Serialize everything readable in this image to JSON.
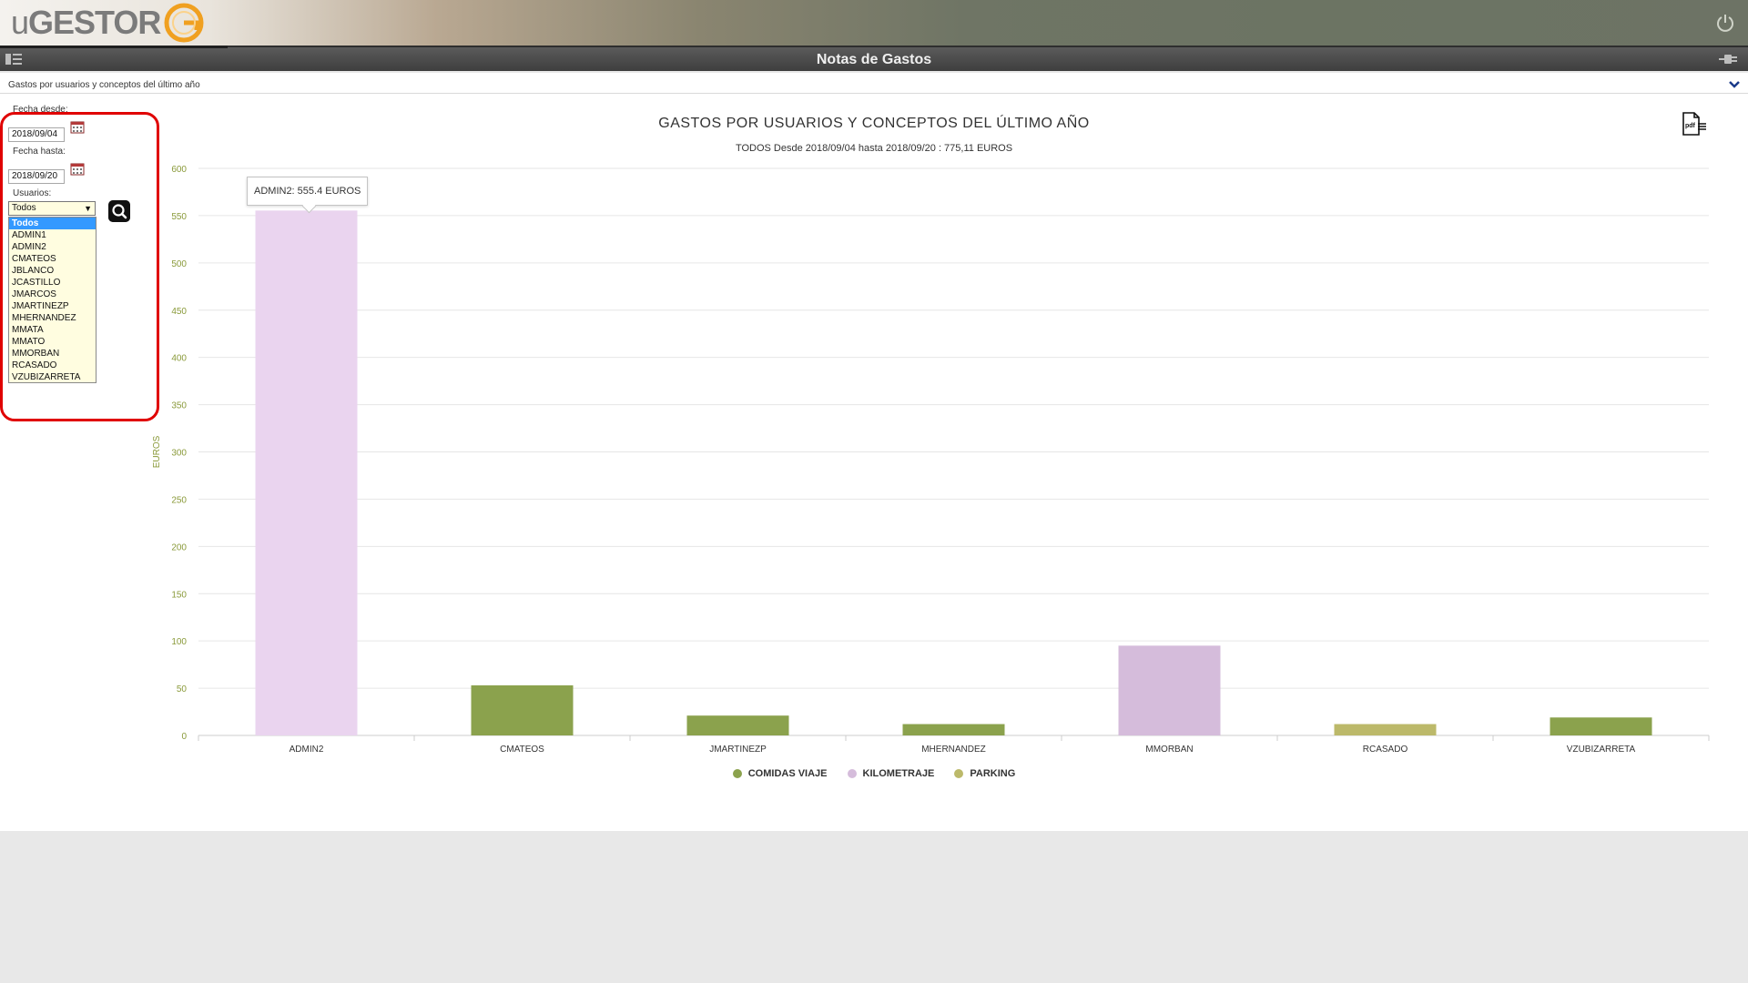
{
  "header": {
    "logo_prefix": "u",
    "logo_main": "GESTOR",
    "power_icon": "power-icon"
  },
  "titlebar": {
    "title": "Notas de Gastos",
    "menu_icon": "menu-icon",
    "plug_icon": "plug-icon"
  },
  "section": {
    "title": "Gastos por usuarios y conceptos del último año"
  },
  "filters": {
    "from_label": "Fecha desde:",
    "from_value": "2018/09/04",
    "to_label": "Fecha hasta:",
    "to_value": "2018/09/20",
    "users_label": "Usuarios:",
    "users_selected": "Todos",
    "users_options": [
      "Todos",
      "ADMIN1",
      "ADMIN2",
      "CMATEOS",
      "JBLANCO",
      "JCASTILLO",
      "JMARCOS",
      "JMARTINEZP",
      "MHERNANDEZ",
      "MMATA",
      "MMATO",
      "MMORBAN",
      "RCASADO",
      "VZUBIZARRETA"
    ]
  },
  "tooltip": {
    "text": "ADMIN2: 555.4 EUROS"
  },
  "chart_data": {
    "type": "bar",
    "title": "GASTOS POR USUARIOS Y CONCEPTOS DEL ÚLTIMO AÑO",
    "subtitle": "TODOS Desde 2018/09/04 hasta 2018/09/20 : 775,11 EUROS",
    "xlabel": "",
    "ylabel": "EUROS",
    "ylim": [
      0,
      600
    ],
    "yticks": [
      0,
      50,
      100,
      150,
      200,
      250,
      300,
      350,
      400,
      450,
      500,
      550,
      600
    ],
    "grid": true,
    "legend_position": "bottom-center",
    "categories": [
      "ADMIN2",
      "CMATEOS",
      "JMARTINEZP",
      "MHERNANDEZ",
      "MMORBAN",
      "RCASADO",
      "VZUBIZARRETA"
    ],
    "series": [
      {
        "name": "COMIDAS VIAJE",
        "color": "#8ba24d",
        "values": [
          0,
          53,
          21,
          12,
          0,
          0,
          19
        ]
      },
      {
        "name": "KILOMETRAJE",
        "color": "#d5bcdb",
        "values": [
          555.4,
          0,
          0,
          0,
          95,
          0,
          0
        ]
      },
      {
        "name": "PARKING",
        "color": "#bcb96a",
        "values": [
          0,
          0,
          0,
          0,
          0,
          12,
          0
        ]
      }
    ],
    "highlight_color": "#ead4ef"
  }
}
